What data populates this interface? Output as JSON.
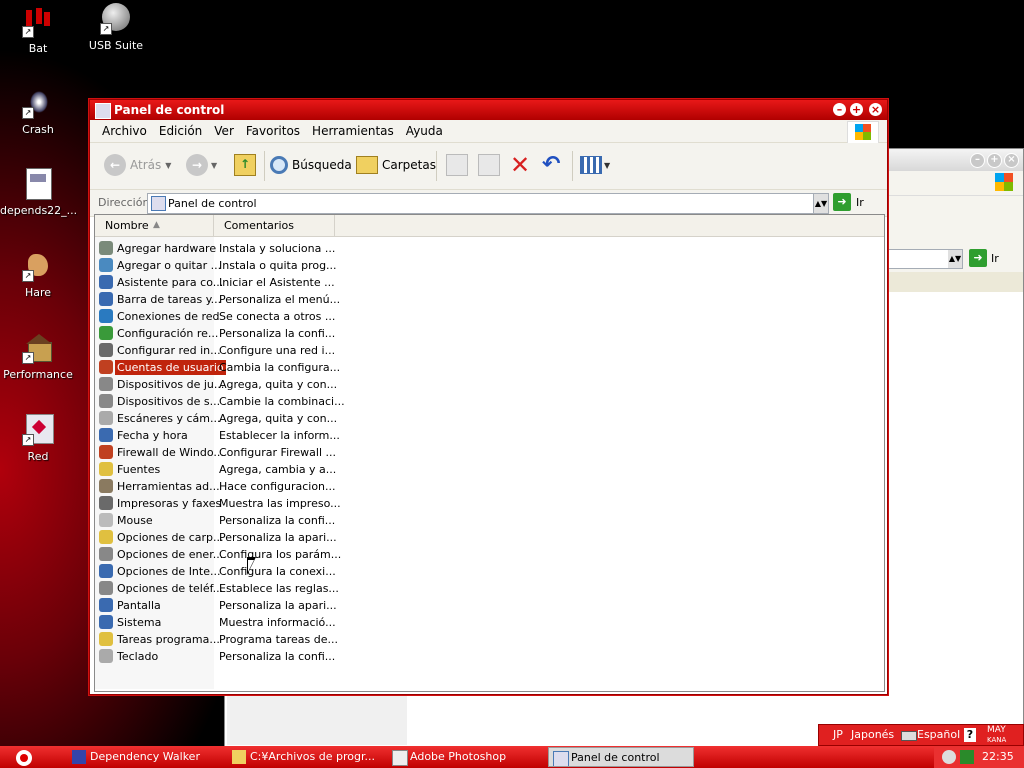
{
  "desktop": {
    "icons": [
      {
        "label": "Bat",
        "icon": "bat-icon"
      },
      {
        "label": "USB Suite",
        "icon": "usb-suite-icon"
      },
      {
        "label": "Crash",
        "icon": "crash-icon"
      },
      {
        "label": "depends22_...",
        "icon": "depends-icon"
      },
      {
        "label": "Hare",
        "icon": "hare-icon"
      },
      {
        "label": "Performance",
        "icon": "performance-icon"
      },
      {
        "label": "Red",
        "icon": "red-icon"
      }
    ]
  },
  "background_window": {
    "go_label": "Ir"
  },
  "window": {
    "title": "Panel de control",
    "menu": [
      "Archivo",
      "Edición",
      "Ver",
      "Favoritos",
      "Herramientas",
      "Ayuda"
    ],
    "toolbar": {
      "back": "Atrás",
      "search": "Búsqueda",
      "folders": "Carpetas"
    },
    "address": {
      "label": "Dirección",
      "value": "Panel de control",
      "go": "Ir"
    },
    "columns": [
      "Nombre",
      "Comentarios"
    ],
    "items": [
      {
        "name": "Agregar hardware",
        "comment": "Instala y soluciona ..."
      },
      {
        "name": "Agregar o quitar ...",
        "comment": "Instala o quita prog..."
      },
      {
        "name": "Asistente para co...",
        "comment": "Iniciar el Asistente ..."
      },
      {
        "name": "Barra de tareas y...",
        "comment": "Personaliza el menú..."
      },
      {
        "name": "Conexiones de red",
        "comment": "Se conecta a otros ..."
      },
      {
        "name": "Configuración re...",
        "comment": "Personaliza la confi..."
      },
      {
        "name": "Configurar red in...",
        "comment": "Configure una red i..."
      },
      {
        "name": "Cuentas de usuario",
        "comment": "Cambia la configura..."
      },
      {
        "name": "Dispositivos de ju...",
        "comment": "Agrega, quita y con..."
      },
      {
        "name": "Dispositivos de s...",
        "comment": "Cambie la combinaci..."
      },
      {
        "name": "Escáneres y cám...",
        "comment": "Agrega, quita y con..."
      },
      {
        "name": "Fecha y hora",
        "comment": "Establecer la inform..."
      },
      {
        "name": "Firewall de Windo...",
        "comment": "Configurar Firewall ..."
      },
      {
        "name": "Fuentes",
        "comment": "Agrega, cambia y a..."
      },
      {
        "name": "Herramientas ad...",
        "comment": "Hace configuracion..."
      },
      {
        "name": "Impresoras y faxes",
        "comment": "Muestra las impreso..."
      },
      {
        "name": "Mouse",
        "comment": "Personaliza la confi..."
      },
      {
        "name": "Opciones de carp...",
        "comment": "Personaliza la apari..."
      },
      {
        "name": "Opciones de ener...",
        "comment": "Configura los parám..."
      },
      {
        "name": "Opciones de Inte...",
        "comment": "Configura la conexi..."
      },
      {
        "name": "Opciones de teléf...",
        "comment": "Establece las reglas..."
      },
      {
        "name": "Pantalla",
        "comment": "Personaliza la apari..."
      },
      {
        "name": "Sistema",
        "comment": "Muestra informació..."
      },
      {
        "name": "Tareas programa...",
        "comment": "Programa tareas de..."
      },
      {
        "name": "Teclado",
        "comment": "Personaliza la confi..."
      }
    ],
    "selected_index": 7
  },
  "taskbar": {
    "tasks": [
      {
        "label": "Dependency Walker",
        "active": false
      },
      {
        "label": "C:¥Archivos de progr...",
        "active": false
      },
      {
        "label": "Adobe Photoshop",
        "active": false
      },
      {
        "label": "Panel de control",
        "active": true
      }
    ],
    "clock": "22:35"
  },
  "langbar": {
    "lang_code": "JP",
    "lang_name": "Japonés",
    "keyboard": "Español",
    "help": "?",
    "caps": "MAY",
    "kana": "KANA"
  }
}
